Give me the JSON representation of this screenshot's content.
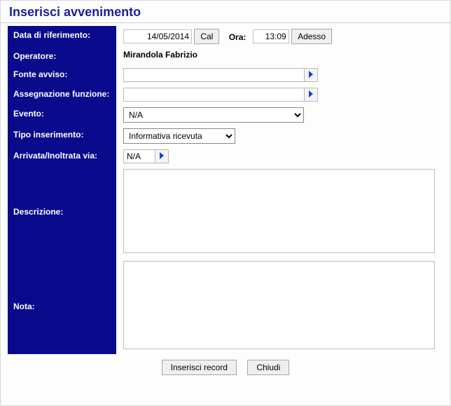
{
  "header": {
    "title": "Inserisci avvenimento"
  },
  "labels": {
    "data_rif": "Data di riferimento:",
    "operatore": "Operatore:",
    "fonte": "Fonte avviso:",
    "assegnazione": "Assegnazione funzione:",
    "evento": "Evento:",
    "tipo_ins": "Tipo inserimento:",
    "arrivata": "Arrivata/Inoltrata via:",
    "descrizione": "Descrizione:",
    "nota": "Nota:",
    "ora": "Ora:"
  },
  "values": {
    "date": "14/05/2014",
    "time": "13:09",
    "operatore": "Mirandola  Fabrizio",
    "fonte": "",
    "assegnazione": "",
    "evento_selected": "N/A",
    "tipo_ins_selected": "Informativa ricevuta",
    "arrivata": "N/A",
    "descrizione": "",
    "nota": ""
  },
  "buttons": {
    "cal": "Cal",
    "adesso": "Adesso",
    "inserisci": "Inserisci record",
    "chiudi": "Chiudi"
  }
}
